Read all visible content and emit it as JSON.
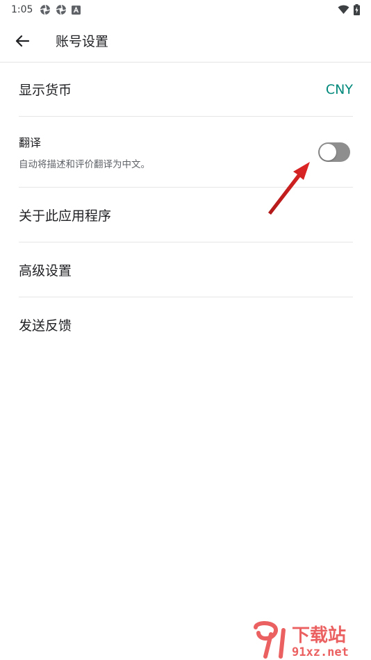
{
  "status_bar": {
    "time": "1:05"
  },
  "app_bar": {
    "title": "账号设置"
  },
  "settings": {
    "currency": {
      "label": "显示货币",
      "value": "CNY"
    },
    "translate": {
      "title": "翻译",
      "description": "自动将描述和评价翻译为中文。",
      "enabled": false
    },
    "about": {
      "label": "关于此应用程序"
    },
    "advanced": {
      "label": "高级设置"
    },
    "feedback": {
      "label": "发送反馈"
    }
  },
  "watermark": {
    "logo_text": "下载站",
    "domain": "91xz.net"
  },
  "colors": {
    "accent": "#00897b",
    "toggle_off": "#8e8e8e",
    "arrow": "#d42020",
    "watermark": "#e84545"
  }
}
